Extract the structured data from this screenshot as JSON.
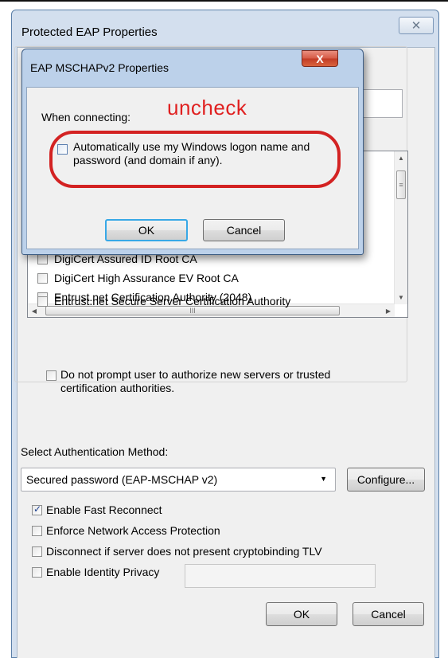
{
  "outer_dialog": {
    "title": "Protected EAP Properties",
    "close_glyph": "✕",
    "certificates": [
      "DigiCert Assured ID Root CA",
      "DigiCert High Assurance EV Root CA",
      "Entrust.net Certification Authority (2048)",
      "Entrust.net Secure Server Certification Authority"
    ],
    "scrollbar": {
      "up_arrow": "▲",
      "down_arrow": "▼",
      "left_arrow": "◀",
      "right_arrow": "▶",
      "thumb_grip": "≡",
      "hthumb_grip": "III"
    },
    "no_prompt_label": "Do not prompt user to authorize new servers or trusted certification authorities.",
    "select_auth_label": "Select Authentication Method:",
    "auth_method_value": "Secured password (EAP-MSCHAP v2)",
    "dropdown_arrow": "▼",
    "configure_label": "Configure...",
    "options": [
      {
        "label": "Enable Fast Reconnect",
        "checked": true
      },
      {
        "label": "Enforce Network Access Protection",
        "checked": false
      },
      {
        "label": "Disconnect if server does not present cryptobinding TLV",
        "checked": false
      },
      {
        "label": "Enable Identity Privacy",
        "checked": false
      }
    ],
    "ok_label": "OK",
    "cancel_label": "Cancel"
  },
  "inner_dialog": {
    "title": "EAP MSCHAPv2 Properties",
    "close_glyph": "X",
    "when_connecting_label": "When connecting:",
    "annotation": "uncheck",
    "auto_logon_label": "Automatically use my Windows logon name and password (and domain if any).",
    "auto_logon_checked": false,
    "ok_label": "OK",
    "cancel_label": "Cancel"
  },
  "colors": {
    "annotation_red": "#d32222",
    "window_frame": "#bcd1ea",
    "close_red": "#c23b26"
  }
}
